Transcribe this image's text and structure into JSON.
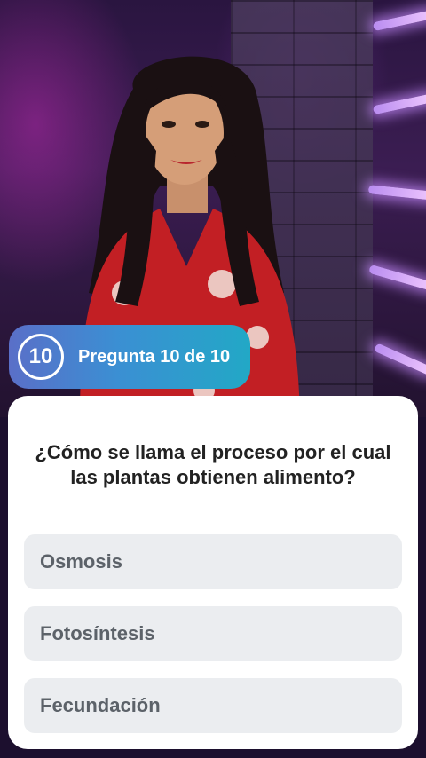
{
  "quiz": {
    "question_number": "10",
    "progress_label": "Pregunta 10 de 10",
    "question": "¿Cómo se llama el proceso por el cual las plantas obtienen alimento?",
    "options": [
      {
        "label": "Osmosis"
      },
      {
        "label": "Fotosíntesis"
      },
      {
        "label": "Fecundación"
      }
    ]
  },
  "colors": {
    "badge_gradient_start": "#5a6fc8",
    "badge_gradient_end": "#22a8c6",
    "card_background": "#ffffff",
    "option_background": "#ebedf0",
    "option_text": "#5c6269",
    "question_text": "#222222"
  },
  "icons": {
    "question_number_badge": "circle-badge-icon"
  }
}
